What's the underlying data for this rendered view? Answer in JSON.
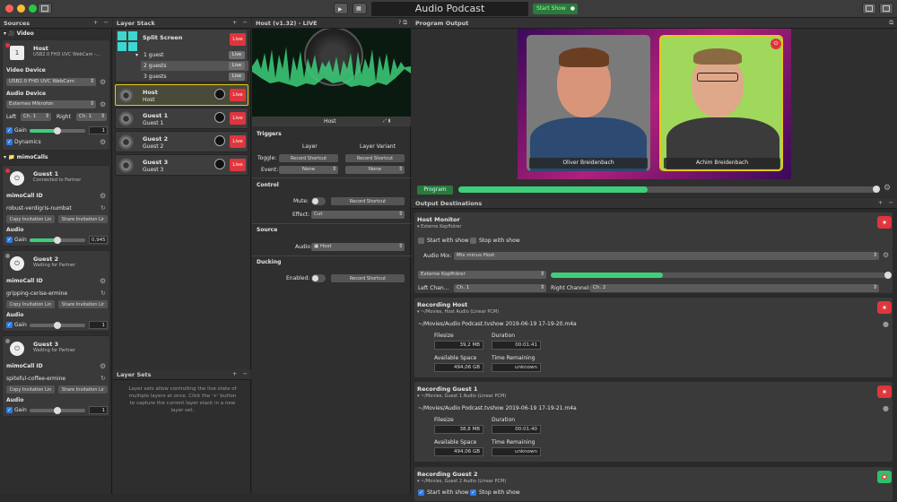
{
  "app": {
    "title": "Audio Podcast",
    "start_show": "Start Show"
  },
  "sources": {
    "header": "Sources",
    "video_section": "Video",
    "host": {
      "name": "Host",
      "device_desc": "USB2.0 FHD UVC WebCam -...",
      "video_device_label": "Video Device",
      "video_device": "USB2.0 FHD UVC WebCam",
      "audio_device_label": "Audio Device",
      "audio_device": "Externes Mikrofon",
      "left_label": "Left",
      "left_value": "Ch. 1",
      "right_label": "Right",
      "right_value": "Ch. 1",
      "gain_label": "Gain",
      "gain_value": "1",
      "dynamics_label": "Dynamics"
    },
    "mimocalls_section": "mimoCalls",
    "guests": [
      {
        "name": "Guest 1",
        "status": "Connected to Partner",
        "id_label": "mimoCall ID",
        "id": "robust-verdigris-numbat",
        "copy_btn": "Copy Invitation Lin",
        "share_btn": "Share Invitation Lir",
        "audio_label": "Audio",
        "gain_label": "Gain",
        "gain_value": "0,945"
      },
      {
        "name": "Guest 2",
        "status": "Waiting for Partner",
        "id_label": "mimoCall ID",
        "id": "gripping-cerise-ermine",
        "copy_btn": "Copy Invitation Lin",
        "share_btn": "Share Invitation Lir",
        "audio_label": "Audio",
        "gain_label": "Gain",
        "gain_value": "1"
      },
      {
        "name": "Guest 3",
        "status": "Waiting for Partner",
        "id_label": "mimoCall ID",
        "id": "spiteful-coffee-ermine",
        "copy_btn": "Copy Invitation Lin",
        "share_btn": "Share Invitation Lir",
        "audio_label": "Audio",
        "gain_label": "Gain",
        "gain_value": "1"
      }
    ]
  },
  "layer_stack": {
    "header": "Layer Stack",
    "split_screen": {
      "name": "Split Screen",
      "variants": [
        "1 guest",
        "2 guests",
        "3 guests"
      ]
    },
    "layers": [
      {
        "name": "Host",
        "sub": "Host"
      },
      {
        "name": "Guest 1",
        "sub": "Guest 1"
      },
      {
        "name": "Guest 2",
        "sub": "Guest 2"
      },
      {
        "name": "Guest 3",
        "sub": "Guest 3"
      }
    ],
    "live_label": "Live",
    "layer_sets_header": "Layer Sets",
    "layer_sets_help": "Layer sets allow controlling the live state of multiple layers at once. Click the '+' button to capture the current layer stack in a new layer set."
  },
  "inspector": {
    "header": "Host (v1.32) - LIVE",
    "preview_label": "Host",
    "triggers": "Triggers",
    "col_layer": "Layer",
    "col_variant": "Layer Variant",
    "toggle_label": "Toggle:",
    "record_shortcut": "Record Shortcut",
    "event_label": "Event:",
    "none": "None",
    "control": "Control",
    "mute_label": "Mute:",
    "effect_label": "Effect:",
    "effect_value": "Cut",
    "source": "Source",
    "audio_label": "Audio",
    "audio_value": "Host",
    "ducking": "Ducking",
    "enabled_label": "Enabled:"
  },
  "program": {
    "header": "Program Output",
    "person1": "Oliver Breidenbach",
    "person2": "Achim Breidenbach",
    "program_btn": "Program",
    "level": 0.45
  },
  "outputs": {
    "header": "Output Destinations",
    "host_monitor": {
      "title": "Host Monitor",
      "sub": "Externe Kopfhörer",
      "start_with_show": "Start with show",
      "stop_with_show": "Stop with show",
      "audio_mix_label": "Audio Mix:",
      "audio_mix": "Mix minus Host",
      "device": "Externe Kopfhörer",
      "left_label": "Left Chan...",
      "left_value": "Ch. 1",
      "right_label": "Right Channel:",
      "right_value": "Ch. 2",
      "level": 0.33
    },
    "recordings": [
      {
        "title": "Recording Host",
        "sub": "~/Movies, Host Audio (Linear PCM)",
        "path": "~/Movies/Audio Podcast.tvshow 2019-06-19 17-19-20.m4a",
        "filesize_label": "Filesize",
        "filesize": "39,2 MB",
        "duration_label": "Duration",
        "duration": "00:01:41",
        "space_label": "Available Space",
        "space": "494,06 GB",
        "remaining_label": "Time Remaining",
        "remaining": "unknown"
      },
      {
        "title": "Recording Guest 1",
        "sub": "~/Movies, Guest 1 Audio (Linear PCM)",
        "path": "~/Movies/Audio Podcast.tvshow 2019-06-19 17-19-21.m4a",
        "filesize_label": "Filesize",
        "filesize": "38,8 MB",
        "duration_label": "Duration",
        "duration": "00:01:40",
        "space_label": "Available Space",
        "space": "494,06 GB",
        "remaining_label": "Time Remaining",
        "remaining": "unknown"
      },
      {
        "title": "Recording Guest 2",
        "sub": "~/Movies, Guest 2 Audio (Linear PCM)",
        "start_with_show": "Start with show",
        "stop_with_show": "Stop with show"
      }
    ]
  },
  "colors": {
    "accent": "#3ecf7a",
    "live": "#e0353d",
    "highlight": "#e6c619"
  }
}
